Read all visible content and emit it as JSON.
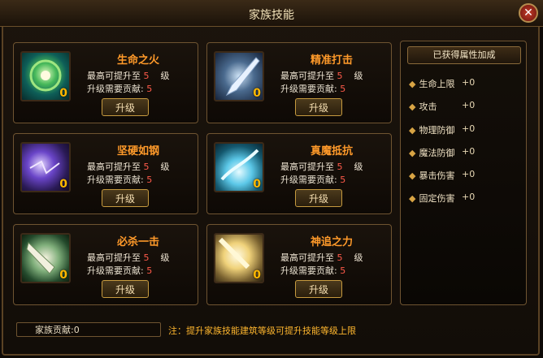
{
  "window": {
    "title": "家族技能",
    "close_label": "✕"
  },
  "skills": [
    {
      "name": "生命之火",
      "max_label": "最高可提升至",
      "max": "5",
      "unit": "级",
      "cost_label": "升级需要贡献:",
      "cost": "5",
      "level": "0",
      "button": "升级"
    },
    {
      "name": "精准打击",
      "max_label": "最高可提升至",
      "max": "5",
      "unit": "级",
      "cost_label": "升级需要贡献:",
      "cost": "5",
      "level": "0",
      "button": "升级"
    },
    {
      "name": "坚硬如钢",
      "max_label": "最高可提升至",
      "max": "5",
      "unit": "级",
      "cost_label": "升级需要贡献:",
      "cost": "5",
      "level": "0",
      "button": "升级"
    },
    {
      "name": "真魔抵抗",
      "max_label": "最高可提升至",
      "max": "5",
      "unit": "级",
      "cost_label": "升级需要贡献:",
      "cost": "5",
      "level": "0",
      "button": "升级"
    },
    {
      "name": "必杀一击",
      "max_label": "最高可提升至",
      "max": "5",
      "unit": "级",
      "cost_label": "升级需要贡献:",
      "cost": "5",
      "level": "0",
      "button": "升级"
    },
    {
      "name": "神追之力",
      "max_label": "最高可提升至",
      "max": "5",
      "unit": "级",
      "cost_label": "升级需要贡献:",
      "cost": "5",
      "level": "0",
      "button": "升级"
    }
  ],
  "bonus_panel": {
    "title": "已获得属性加成",
    "attributes": [
      {
        "label": "生命上限",
        "value": "+0"
      },
      {
        "label": "攻击",
        "value": "+0"
      },
      {
        "label": "物理防御",
        "value": "+0"
      },
      {
        "label": "魔法防御",
        "value": "+0"
      },
      {
        "label": "暴击伤害",
        "value": "+0"
      },
      {
        "label": "固定伤害",
        "value": "+0"
      }
    ]
  },
  "footer": {
    "contribution": "家族贡献:0",
    "note": "注：提升家族技能建筑等级可提升技能等级上限"
  },
  "colors": {
    "accent": "#ff9a2a",
    "frame": "#6f5431",
    "note": "#ffb72e"
  }
}
